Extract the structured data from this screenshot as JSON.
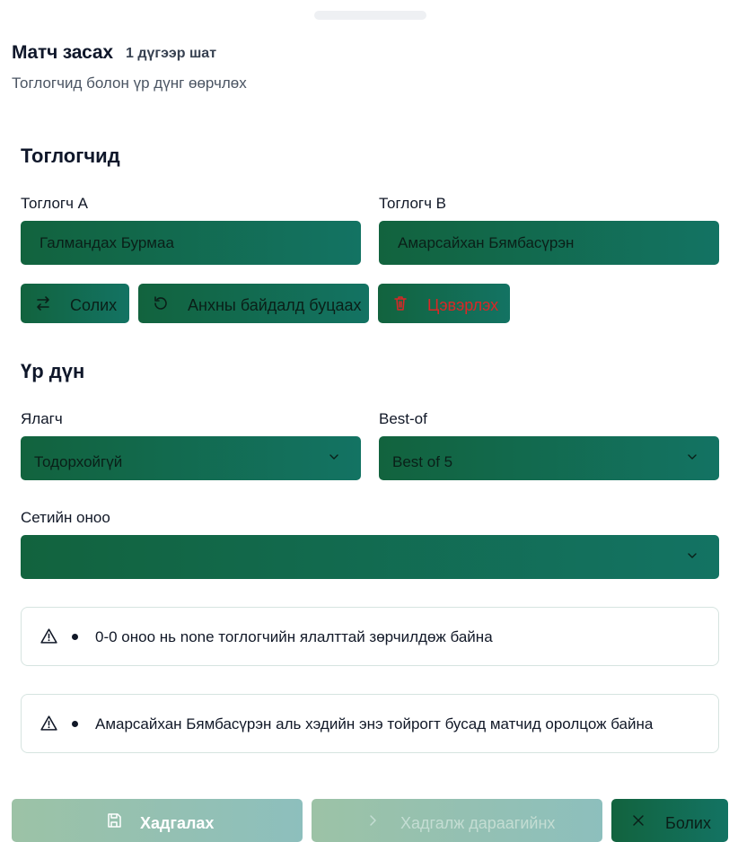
{
  "header": {
    "title": "Матч засах",
    "stage_badge": "1 дүгээр шат",
    "subtitle": "Тоглогчид болон үр дүнг өөрчлөх"
  },
  "players_section": {
    "title": "Тоглогчид",
    "player_a": {
      "label": "Тоглогч A",
      "value": "Галмандах Бурмаа"
    },
    "player_b": {
      "label": "Тоглогч B",
      "value": "Амарсайхан Бямбасүрэн"
    },
    "buttons": {
      "swap": "Солих",
      "reset": "Анхны байдалд буцаах",
      "clear": "Цэвэрлэх"
    }
  },
  "result_section": {
    "title": "Үр дүн",
    "winner": {
      "label": "Ялагч",
      "value": "Тодорхойгүй"
    },
    "best_of": {
      "label": "Best-of",
      "value": "Best of 5"
    },
    "set_scores": {
      "label": "Сетийн оноо",
      "value": ""
    }
  },
  "warnings": [
    "0-0 оноо нь none тоглогчийн ялалттай зөрчилдөж байна",
    "Амарсайхан Бямбасүрэн аль хэдийн энэ тойрогт бусад матчид оролцож байна"
  ],
  "footer": {
    "save": "Хадгалах",
    "save_next": "Хадгалж дараагийнх",
    "cancel": "Болих"
  },
  "colors": {
    "primary_start": "#12633e",
    "primary_end": "#137363",
    "danger": "#dc2626",
    "disabled_start": "#9cc2a6",
    "disabled_end": "#8dbfbd"
  }
}
